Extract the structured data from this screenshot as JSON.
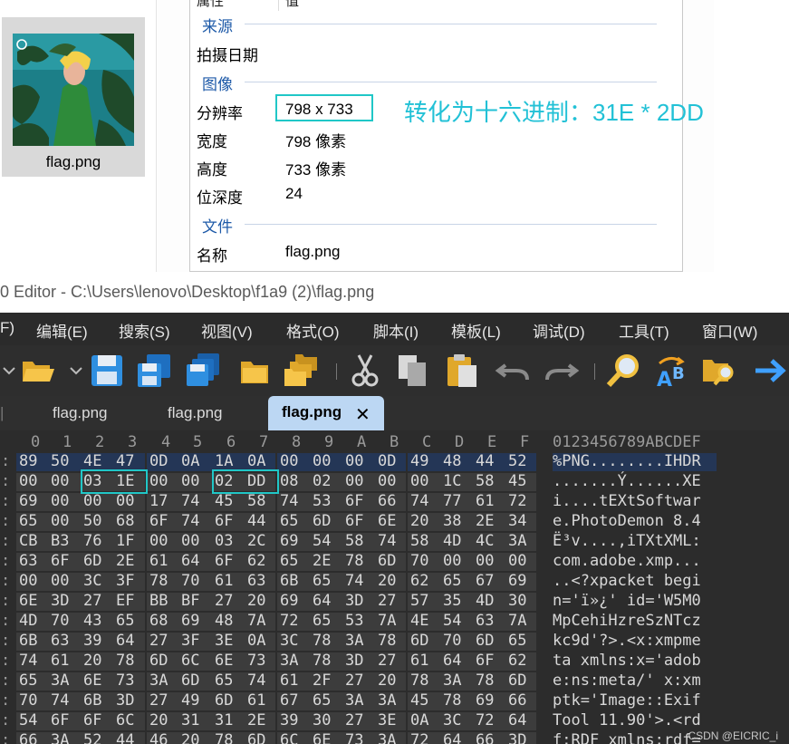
{
  "file_thumbnail": {
    "name": "flag.png"
  },
  "details": {
    "header_label": "属性",
    "header_value": "值",
    "sections": {
      "source": "来源",
      "image": "图像",
      "file": "文件"
    },
    "rows": {
      "date_taken_label": "拍摄日期",
      "resolution_label": "分辨率",
      "resolution_value": "798 x 733",
      "width_label": "宽度",
      "width_value": "798 像素",
      "height_label": "高度",
      "height_value": "733 像素",
      "bit_depth_label": "位深度",
      "bit_depth_value": "24",
      "name_label": "名称",
      "name_value": "flag.png"
    },
    "annotation": "转化为十六进制：31E  * 2DD"
  },
  "editor": {
    "title": "0 Editor - C:\\Users\\lenovo\\Desktop\\f1a9 (2)\\flag.png",
    "menu": [
      "F)",
      "编辑(E)",
      "搜索(S)",
      "视图(V)",
      "格式(O)",
      "脚本(I)",
      "模板(L)",
      "调试(D)",
      "工具(T)",
      "窗口(W)"
    ],
    "tabs": [
      "flag.png",
      "flag.png",
      "flag.png"
    ],
    "active_tab": "flag.png",
    "close_glyph": "✕",
    "column_headers": [
      "0",
      "1",
      "2",
      "3",
      "4",
      "5",
      "6",
      "7",
      "8",
      "9",
      "A",
      "B",
      "C",
      "D",
      "E",
      "F"
    ],
    "ascii_header": "0123456789ABCDEF",
    "rows": [
      {
        "hex": [
          "89",
          "50",
          "4E",
          "47",
          "0D",
          "0A",
          "1A",
          "0A",
          "00",
          "00",
          "00",
          "0D",
          "49",
          "48",
          "44",
          "52"
        ],
        "ascii": "%PNG........IHDR",
        "selected": true
      },
      {
        "hex": [
          "00",
          "00",
          "03",
          "1E",
          "00",
          "00",
          "02",
          "DD",
          "08",
          "02",
          "00",
          "00",
          "00",
          "1C",
          "58",
          "45"
        ],
        "ascii": ".......Ý......XE"
      },
      {
        "hex": [
          "69",
          "00",
          "00",
          "00",
          "17",
          "74",
          "45",
          "58",
          "74",
          "53",
          "6F",
          "66",
          "74",
          "77",
          "61",
          "72"
        ],
        "ascii": "i....tEXtSoftwar"
      },
      {
        "hex": [
          "65",
          "00",
          "50",
          "68",
          "6F",
          "74",
          "6F",
          "44",
          "65",
          "6D",
          "6F",
          "6E",
          "20",
          "38",
          "2E",
          "34"
        ],
        "ascii": "e.PhotoDemon 8.4"
      },
      {
        "hex": [
          "CB",
          "B3",
          "76",
          "1F",
          "00",
          "00",
          "03",
          "2C",
          "69",
          "54",
          "58",
          "74",
          "58",
          "4D",
          "4C",
          "3A"
        ],
        "ascii": "Ë³v....,iTXtXML:"
      },
      {
        "hex": [
          "63",
          "6F",
          "6D",
          "2E",
          "61",
          "64",
          "6F",
          "62",
          "65",
          "2E",
          "78",
          "6D",
          "70",
          "00",
          "00",
          "00"
        ],
        "ascii": "com.adobe.xmp..."
      },
      {
        "hex": [
          "00",
          "00",
          "3C",
          "3F",
          "78",
          "70",
          "61",
          "63",
          "6B",
          "65",
          "74",
          "20",
          "62",
          "65",
          "67",
          "69"
        ],
        "ascii": "..<?xpacket begi"
      },
      {
        "hex": [
          "6E",
          "3D",
          "27",
          "EF",
          "BB",
          "BF",
          "27",
          "20",
          "69",
          "64",
          "3D",
          "27",
          "57",
          "35",
          "4D",
          "30"
        ],
        "ascii": "n='ï»¿' id='W5M0"
      },
      {
        "hex": [
          "4D",
          "70",
          "43",
          "65",
          "68",
          "69",
          "48",
          "7A",
          "72",
          "65",
          "53",
          "7A",
          "4E",
          "54",
          "63",
          "7A"
        ],
        "ascii": "MpCehiHzreSzNTcz"
      },
      {
        "hex": [
          "6B",
          "63",
          "39",
          "64",
          "27",
          "3F",
          "3E",
          "0A",
          "3C",
          "78",
          "3A",
          "78",
          "6D",
          "70",
          "6D",
          "65"
        ],
        "ascii": "kc9d'?>.<x:xmpme"
      },
      {
        "hex": [
          "74",
          "61",
          "20",
          "78",
          "6D",
          "6C",
          "6E",
          "73",
          "3A",
          "78",
          "3D",
          "27",
          "61",
          "64",
          "6F",
          "62"
        ],
        "ascii": "ta xmlns:x='adob"
      },
      {
        "hex": [
          "65",
          "3A",
          "6E",
          "73",
          "3A",
          "6D",
          "65",
          "74",
          "61",
          "2F",
          "27",
          "20",
          "78",
          "3A",
          "78",
          "6D"
        ],
        "ascii": "e:ns:meta/' x:xm"
      },
      {
        "hex": [
          "70",
          "74",
          "6B",
          "3D",
          "27",
          "49",
          "6D",
          "61",
          "67",
          "65",
          "3A",
          "3A",
          "45",
          "78",
          "69",
          "66"
        ],
        "ascii": "ptk='Image::Exif"
      },
      {
        "hex": [
          "54",
          "6F",
          "6F",
          "6C",
          "20",
          "31",
          "31",
          "2E",
          "39",
          "30",
          "27",
          "3E",
          "0A",
          "3C",
          "72",
          "64"
        ],
        "ascii": "Tool 11.90'>.<rd"
      },
      {
        "hex": [
          "66",
          "3A",
          "52",
          "44",
          "46",
          "20",
          "78",
          "6D",
          "6C",
          "6E",
          "73",
          "3A",
          "72",
          "64",
          "66",
          "3D"
        ],
        "ascii": "f:RDF xmlns:rdf="
      }
    ]
  },
  "watermark": "CSDN @EICRIC_i",
  "colors": {
    "highlight": "#20c7c7",
    "annotation": "#22c1d6",
    "section_head": "#1e5aa8",
    "editor_bg": "#2c2c2c",
    "active_tab": "#bcd7f3",
    "selection": "#243656"
  }
}
